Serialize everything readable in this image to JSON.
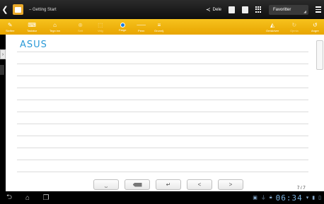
{
  "topbar": {
    "title": "– Getting Start",
    "share_label": "Dele",
    "favorites_label": "Favoritter"
  },
  "toolbar": {
    "tools": [
      {
        "label": "Skrifee",
        "icon": "pen-icon"
      },
      {
        "label": "Tastatur",
        "icon": "keyboard-icon"
      },
      {
        "label": "Tegn inn",
        "icon": "draw-icon"
      },
      {
        "label": "Sett",
        "icon": "insert-icon"
      },
      {
        "label": "Velg",
        "icon": "select-icon"
      },
      {
        "label": "Farge",
        "icon": "color-icon"
      },
      {
        "label": "Penn",
        "icon": "pen-width-icon"
      },
      {
        "label": "Grunnlj.",
        "icon": "baseline-icon"
      },
      {
        "label": "Omskriver",
        "icon": "eraser-icon"
      },
      {
        "label": "Gjenta",
        "icon": "redo-icon"
      },
      {
        "label": "Angre",
        "icon": "undo-icon"
      }
    ],
    "accent_color": "#F2B60F",
    "pen_color": "#1E7FE0"
  },
  "note": {
    "ink_text": "ASUS",
    "page_indicator": "7 / 7"
  },
  "keys": [
    "⎵",
    "⌫",
    "↵",
    "<",
    ">"
  ],
  "status": {
    "clock": "06:34"
  }
}
